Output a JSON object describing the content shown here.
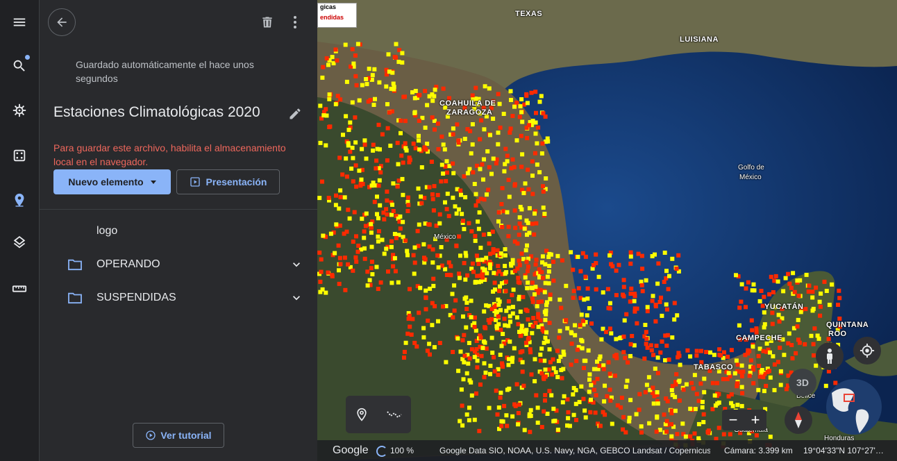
{
  "panel": {
    "autosave_text": "Guardado automáticamente el hace unos segundos",
    "title": "Estaciones Climatológicas 2020",
    "warning": "Para guardar este archivo, habilita el almacenamiento local en el navegador.",
    "new_button": "Nuevo elemento",
    "present_button": "Presentación",
    "items": [
      {
        "label": "logo"
      },
      {
        "label": "OPERANDO"
      },
      {
        "label": "SUSPENDIDAS"
      }
    ],
    "tutorial_button": "Ver tutorial"
  },
  "map": {
    "labels": {
      "texas": "TEXAS",
      "luisiana": "LUISIANA",
      "coahuila": "COAHUILA DE",
      "zaragoza": "ZARAGOZA",
      "golfo": "Golfo de",
      "golfo2": "México",
      "mexico": "México",
      "campeche": "CAMPECHE",
      "quintana": "QUINTANA",
      "roo": "ROO",
      "belice": "Belice",
      "honduras": "Honduras",
      "guatemala": "Guatemala",
      "yucatan": "YUCATÁN",
      "tabasco": "TABASCO"
    },
    "legend": {
      "line1": "gicas",
      "line2": "endidas"
    },
    "three_d": "3D",
    "zoom_out": "−",
    "zoom_in": "+",
    "status": {
      "google": "Google",
      "zoom_pct": "100 %",
      "attribution": "Google  Data SIO, NOAA, U.S. Navy, NGA, GEBCO  Landsat / Copernicus",
      "camera": "Cámara: 3.399 km",
      "coords": "19°04'33\"N 107°27'…"
    },
    "colors": {
      "operando": "#ffff00",
      "suspendidas": "#ff2a00",
      "ocean": "#0d2a55",
      "land": "#3a4a2e"
    }
  },
  "icons": {
    "menu": "menu-icon",
    "search": "search-icon",
    "voyager": "ship-wheel-icon",
    "feeling_lucky": "dice-icon",
    "projects": "map-pin-icon",
    "layers": "layers-icon",
    "measure": "ruler-icon"
  }
}
